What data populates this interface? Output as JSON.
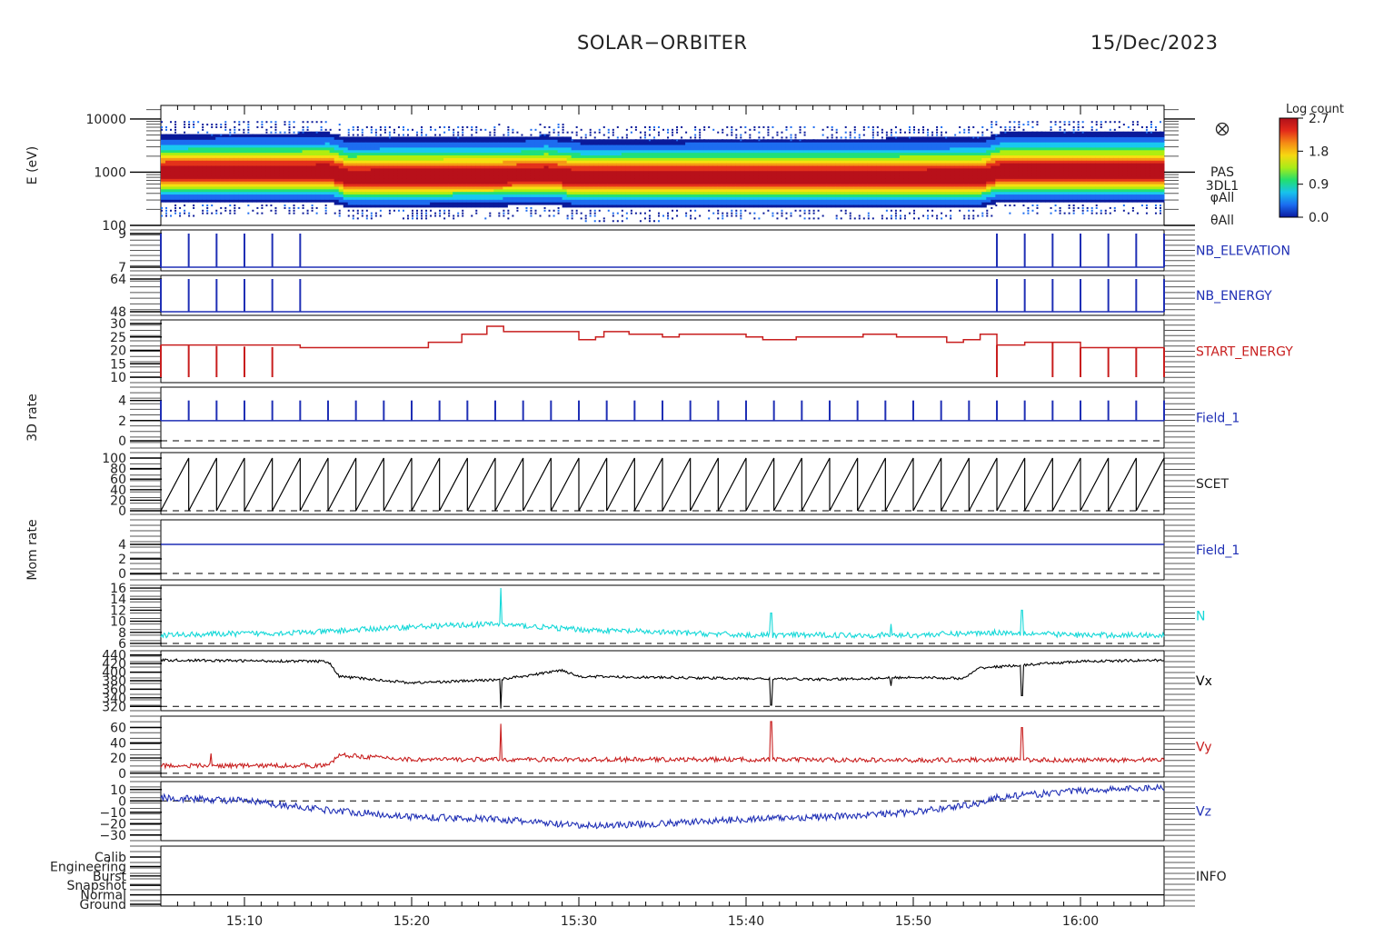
{
  "header": {
    "title": "SOLAR−ORBITER",
    "date": "15/Dec/2023"
  },
  "colors": {
    "blue": "#1f2fb5",
    "red": "#c81e1e",
    "cyan": "#14d8d8",
    "black": "#000000"
  },
  "chart_data": [
    {
      "type": "heatmap",
      "panel": "spectrogram",
      "ylabel": "E (eV)",
      "yscale": "log",
      "ylim": [
        100,
        20000
      ],
      "yticks": [
        "10000",
        "1000",
        "100"
      ],
      "side_labels": [
        "PAS",
        "3DL1",
        "φAll",
        "θAll"
      ],
      "colorbar": {
        "title": "Log count",
        "ticks": [
          "2.7",
          "1.8",
          "0.9",
          "0.0"
        ],
        "range": [
          0.0,
          2.7
        ]
      },
      "peak_energy_trend": {
        "times": [
          "15:05",
          "15:15",
          "15:16",
          "15:25",
          "15:28",
          "15:30",
          "15:54",
          "15:55",
          "16:05"
        ],
        "energy_eV": [
          900,
          950,
          750,
          780,
          850,
          720,
          760,
          950,
          950
        ]
      }
    },
    {
      "type": "line",
      "panel": "nb_elevation",
      "name": "NB_ELEVATION",
      "yticks": [
        "9",
        "7"
      ],
      "ylim": [
        7,
        9
      ],
      "baseline": 7,
      "spike_value": 9,
      "spike_times": [
        "15:05",
        "15:06:40",
        "15:08:20",
        "15:10",
        "15:11:40",
        "15:13:20",
        "15:55",
        "15:56:40",
        "15:58:20",
        "16:00",
        "16:01:40",
        "16:03:20",
        "16:05"
      ]
    },
    {
      "type": "line",
      "panel": "nb_energy",
      "name": "NB_ENERGY",
      "yticks": [
        "64",
        "48"
      ],
      "ylim": [
        48,
        64
      ],
      "baseline": 48,
      "spike_value": 64,
      "spike_times": [
        "15:05",
        "15:06:40",
        "15:08:20",
        "15:10",
        "15:11:40",
        "15:13:20",
        "15:55",
        "15:56:40",
        "15:58:20",
        "16:00",
        "16:01:40",
        "16:03:20",
        "16:05"
      ]
    },
    {
      "type": "line",
      "panel": "start_energy",
      "name": "START_ENERGY",
      "yticks": [
        "30",
        "25",
        "20",
        "15",
        "10"
      ],
      "ylim": [
        10,
        30
      ],
      "steps": [
        [
          "15:05",
          22
        ],
        [
          "15:13:20",
          21
        ],
        [
          "15:21",
          23
        ],
        [
          "15:23",
          26
        ],
        [
          "15:24:30",
          29
        ],
        [
          "15:25:30",
          27
        ],
        [
          "15:30",
          24
        ],
        [
          "15:31",
          25
        ],
        [
          "15:31:30",
          27
        ],
        [
          "15:33",
          26
        ],
        [
          "15:35",
          25
        ],
        [
          "15:36",
          26
        ],
        [
          "15:40",
          25
        ],
        [
          "15:41",
          24
        ],
        [
          "15:43",
          25
        ],
        [
          "15:47",
          26
        ],
        [
          "15:49",
          25
        ],
        [
          "15:52",
          23
        ],
        [
          "15:53",
          24
        ],
        [
          "15:54",
          26
        ],
        [
          "15:55",
          22
        ],
        [
          "15:56:40",
          23
        ],
        [
          "15:58:20",
          23
        ],
        [
          "16:00",
          21
        ],
        [
          "16:03:20",
          21
        ],
        [
          "16:05",
          21
        ]
      ],
      "dip_value": 10,
      "dip_times": [
        "15:05",
        "15:06:40",
        "15:08:20",
        "15:10",
        "15:11:40",
        "15:55",
        "15:58:20",
        "16:00",
        "16:01:40",
        "16:03:20",
        "16:05"
      ]
    },
    {
      "type": "line",
      "panel": "rate_3d",
      "name": "Field_1",
      "ylabel": "3D rate",
      "yticks": [
        "4",
        "2",
        "0"
      ],
      "ylim": [
        -0.5,
        4.8
      ],
      "baseline": 2,
      "spike_value": 4,
      "spike_interval_s": 100,
      "reference_line": 0
    },
    {
      "type": "line",
      "panel": "scet",
      "name": "SCET",
      "yticks": [
        "100",
        "80",
        "60",
        "40",
        "20",
        "0"
      ],
      "ylim": [
        0,
        100
      ],
      "sawtooth": {
        "period_s": 100,
        "min": 0,
        "max": 100
      },
      "reference_line": 0
    },
    {
      "type": "line",
      "panel": "rate_mom",
      "name": "Field_1",
      "ylabel": "Mom rate",
      "yticks": [
        "4",
        "2",
        "0"
      ],
      "ylim": [
        -0.5,
        7
      ],
      "value": 4,
      "reference_line": 0
    },
    {
      "type": "line",
      "panel": "density",
      "name": "N",
      "yticks": [
        "16",
        "14",
        "12",
        "10",
        "8",
        "6"
      ],
      "ylim": [
        5.5,
        16.5
      ],
      "trend": {
        "times": [
          "15:05",
          "15:14",
          "15:20",
          "15:25",
          "15:30",
          "15:40",
          "15:50",
          "15:55",
          "16:00",
          "16:05"
        ],
        "values": [
          7.5,
          8,
          9,
          9.5,
          8.5,
          7.5,
          7.5,
          8,
          7.5,
          7.5
        ]
      },
      "noise": 0.5,
      "spikes": [
        {
          "time": "15:25:20",
          "value": 16
        },
        {
          "time": "15:41:30",
          "value": 11.5
        },
        {
          "time": "15:56:30",
          "value": 12
        },
        {
          "time": "15:48:40",
          "value": 9.5
        }
      ],
      "reference_line": 6
    },
    {
      "type": "line",
      "panel": "vx",
      "name": "Vx",
      "yticks": [
        "440",
        "420",
        "400",
        "380",
        "360",
        "340",
        "320"
      ],
      "ylim": [
        310,
        450
      ],
      "trend": {
        "times": [
          "15:05",
          "15:15",
          "15:15:40",
          "15:20",
          "15:25",
          "15:27",
          "15:29",
          "15:30",
          "15:40",
          "15:45",
          "15:50",
          "15:53",
          "15:54",
          "16:00",
          "16:05"
        ],
        "values": [
          428,
          425,
          390,
          375,
          382,
          392,
          405,
          390,
          385,
          383,
          388,
          385,
          410,
          425,
          428
        ]
      },
      "noise": 3,
      "spikes": [
        {
          "time": "15:25:20",
          "value": 315
        },
        {
          "time": "15:41:30",
          "value": 323
        },
        {
          "time": "15:56:30",
          "value": 345
        },
        {
          "time": "15:48:40",
          "value": 368
        }
      ],
      "reference_line": 320
    },
    {
      "type": "line",
      "panel": "vy",
      "name": "Vy",
      "yticks": [
        "60",
        "40",
        "20",
        "0"
      ],
      "ylim": [
        -5,
        75
      ],
      "trend": {
        "times": [
          "15:05",
          "15:15",
          "15:15:40",
          "15:20",
          "15:25",
          "15:30",
          "15:40",
          "15:50",
          "15:55",
          "16:00",
          "16:05"
        ],
        "values": [
          10,
          10,
          24,
          18,
          18,
          18,
          18,
          17,
          18,
          17,
          18
        ]
      },
      "noise": 3,
      "spikes": [
        {
          "time": "15:25:20",
          "value": 65
        },
        {
          "time": "15:41:30",
          "value": 68
        },
        {
          "time": "15:56:30",
          "value": 60
        },
        {
          "time": "15:08",
          "value": 26
        }
      ],
      "reference_line": 0
    },
    {
      "type": "line",
      "panel": "vz",
      "name": "Vz",
      "yticks": [
        "10",
        "0",
        "−10",
        "−20",
        "−30"
      ],
      "ylim": [
        -35,
        17
      ],
      "trend": {
        "times": [
          "15:05",
          "15:10",
          "15:15",
          "15:20",
          "15:25",
          "15:30",
          "15:35",
          "15:40",
          "15:45",
          "15:50",
          "15:54",
          "15:55",
          "16:00",
          "16:05"
        ],
        "values": [
          3,
          0,
          -8,
          -14,
          -16,
          -22,
          -20,
          -16,
          -14,
          -10,
          -2,
          3,
          9,
          12
        ]
      },
      "noise": 3,
      "reference_line": 0
    },
    {
      "type": "line",
      "panel": "info",
      "name": "INFO",
      "yticks": [
        "Calib",
        "Engineering",
        "Burst",
        "Snapshot",
        "Normal",
        "Ground"
      ],
      "level": "Normal"
    },
    {
      "type": "axis",
      "x_range": [
        "15:05",
        "16:05"
      ],
      "xticks": [
        "15:10",
        "15:20",
        "15:30",
        "15:40",
        "15:50",
        "16:00"
      ]
    }
  ]
}
